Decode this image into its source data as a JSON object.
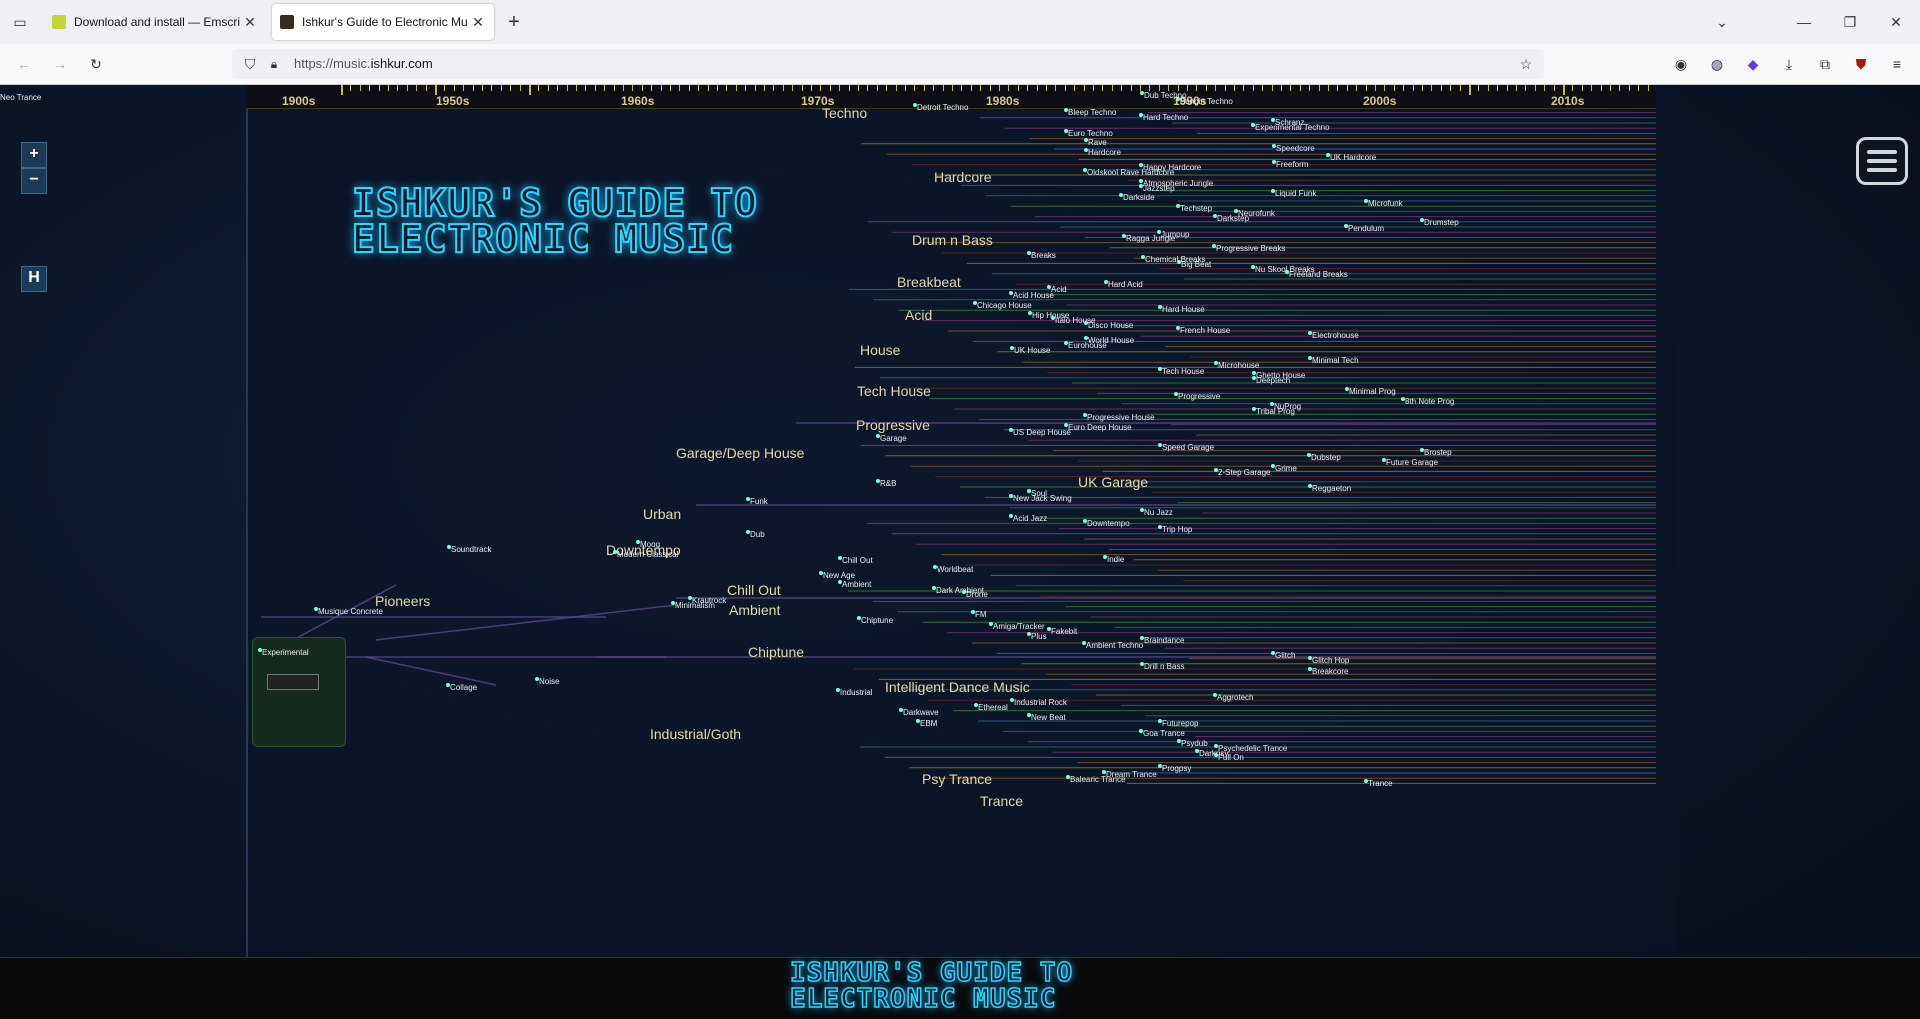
{
  "browser": {
    "tabs": [
      {
        "title": "Download and install — Emscri",
        "active": false
      },
      {
        "title": "Ishkur's Guide to Electronic Mu",
        "active": true
      }
    ],
    "url_prefix": "https://music.",
    "url_host": "ishkur.com"
  },
  "controls": {
    "zoom_in": "+",
    "zoom_out": "−",
    "home": "H"
  },
  "logo": {
    "line1": "ISHKUR'S GUIDE TO",
    "line2": "ELECTRONIC MUSIC"
  },
  "timeline": {
    "decades": [
      "1900s",
      "1950s",
      "1960s",
      "1970s",
      "1980s",
      "1990s",
      "2000s",
      "2010s"
    ]
  },
  "genres": [
    "Techno",
    "Hardcore",
    "Drum n Bass",
    "Breakbeat",
    "Acid",
    "House",
    "Tech House",
    "Progressive",
    "Garage/Deep House",
    "UK Garage",
    "Urban",
    "Downtempo",
    "Pioneers",
    "Chill Out",
    "Ambient",
    "Chiptune",
    "Intelligent Dance Music",
    "Industrial/Goth",
    "Psy Trance",
    "Trance"
  ],
  "subgenres": [
    "Detroit Techno",
    "Dub Techno",
    "Bangin Techno",
    "Bleep Techno",
    "Hard Techno",
    "Schranz",
    "Experimental Techno",
    "Euro Techno",
    "Rave",
    "Hardcore",
    "Speedcore",
    "UK Hardcore",
    "Oldskool Rave Hardcore",
    "Happy Hardcore",
    "Freeform",
    "Atmospheric Jungle",
    "Jazzstep",
    "Liquid Funk",
    "Darkside",
    "Techstep",
    "Neurofunk",
    "Darkstep",
    "Microfunk",
    "Jumpup",
    "Ragga Jungle",
    "Pendulum",
    "Drumstep",
    "Breaks",
    "Progressive Breaks",
    "Chemical Breaks",
    "Big Beat",
    "Nu Skool Breaks",
    "Freeland Breaks",
    "Hard Acid",
    "Acid",
    "Acid House",
    "Chicago House",
    "Hard House",
    "Hip House",
    "Italo House",
    "Disco House",
    "French House",
    "Electrohouse",
    "World House",
    "Eurohouse",
    "UK House",
    "Microhouse",
    "Minimal Tech",
    "Tech House",
    "Ghetto House",
    "Deeptech",
    "Minimal Prog",
    "8th Note Prog",
    "Progressive",
    "NuProg",
    "Tribal Prog",
    "Progressive House",
    "Euro Deep House",
    "US Deep House",
    "Garage",
    "Speed Garage",
    "Brostep",
    "Dubstep",
    "Future Garage",
    "2-Step Garage",
    "Grime",
    "R&B",
    "Reggaeton",
    "Soul",
    "New Jack Swing",
    "Funk",
    "Nu Jazz",
    "Acid Jazz",
    "Downtempo",
    "Trip Hop",
    "Dub",
    "Moog",
    "Modern Classical",
    "Soundtrack",
    "Indie",
    "Chill Out",
    "Worldbeat",
    "New Age",
    "Ambient",
    "Dark Ambient",
    "Drone",
    "Krautrock",
    "Minimalism",
    "Musique Concrete",
    "Chiptune",
    "FM",
    "Amiga/Tracker",
    "Fakebit",
    "Plus",
    "Braindance",
    "Ambient Techno",
    "Experimental",
    "Glitch",
    "Glitch Hop",
    "Drill n Bass",
    "Breakcore",
    "Noise",
    "Collage",
    "Industrial",
    "Aggrotech",
    "Industrial Rock",
    "Ethereal",
    "Darkwave",
    "New Beat",
    "EBM",
    "Futurepop",
    "Goa Trance",
    "Psydub",
    "Psychedelic Trance",
    "Darkpsy",
    "Full On",
    "Progpsy",
    "Dream Trance",
    "Balearic Trance",
    "Trance",
    "Neo Trance"
  ]
}
